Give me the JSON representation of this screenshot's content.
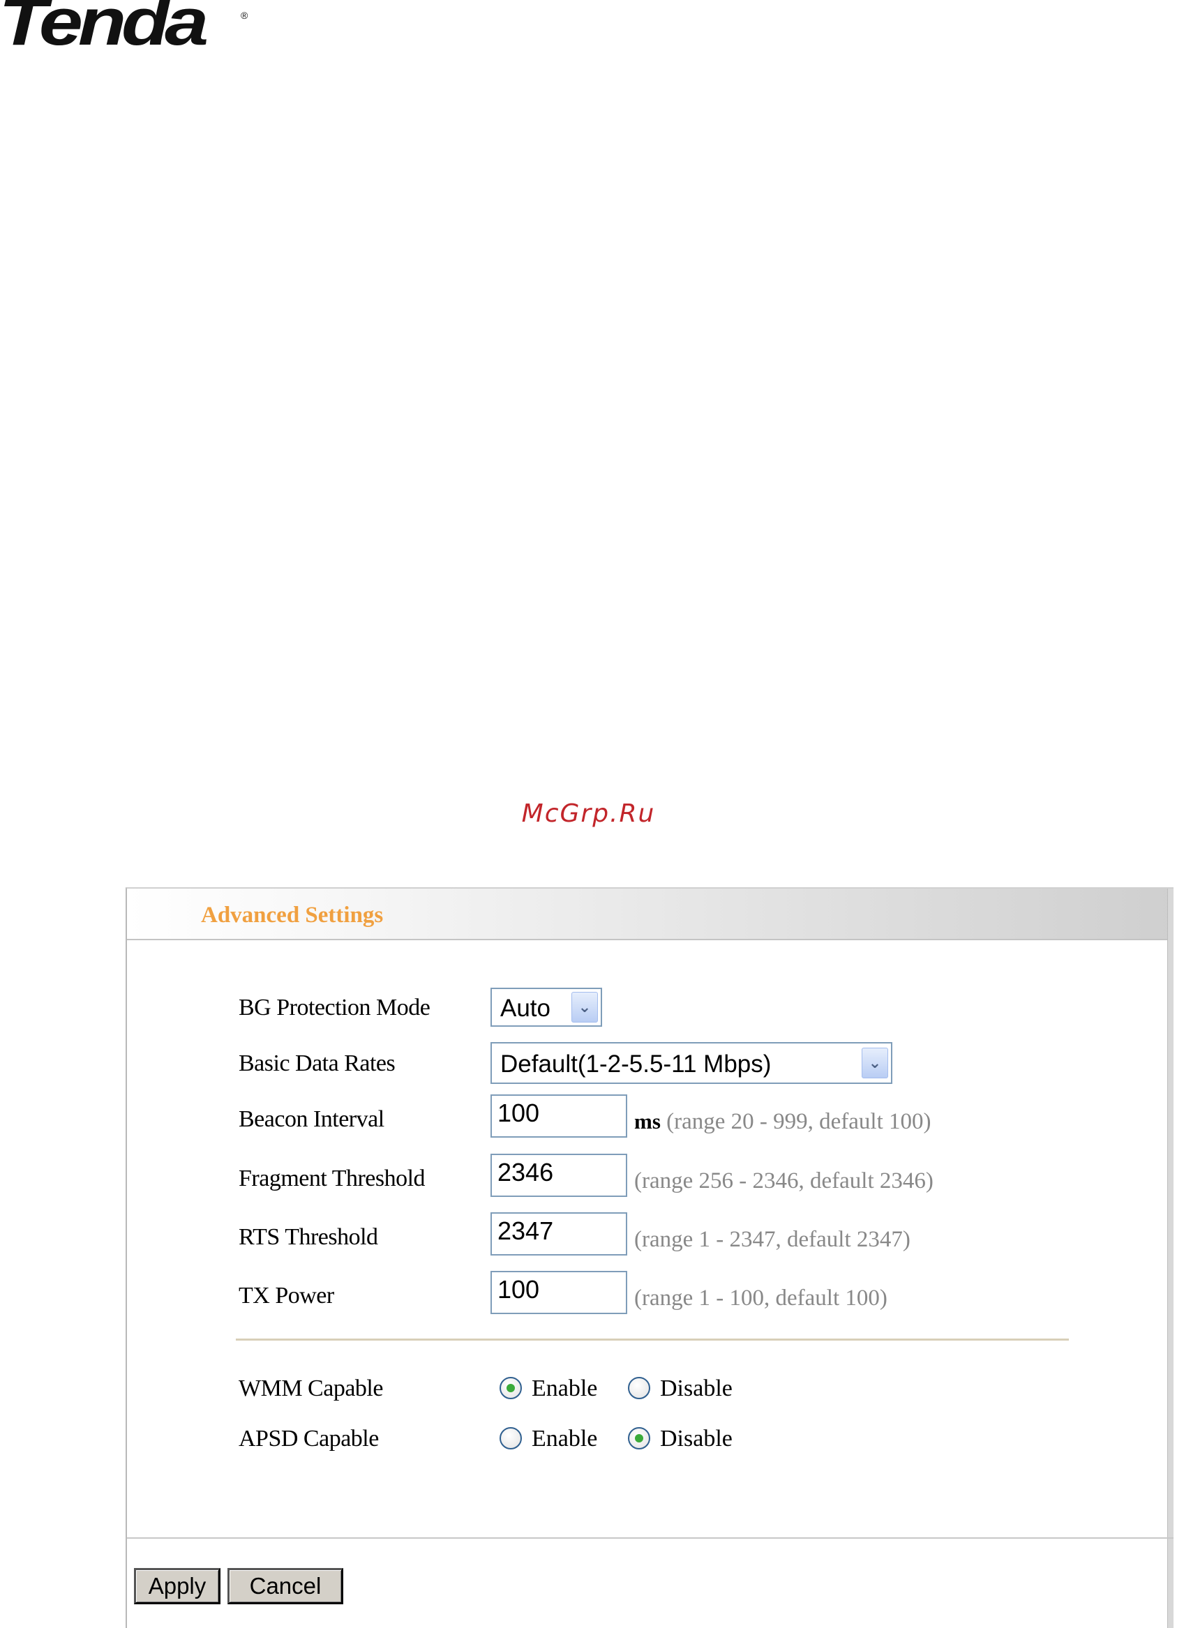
{
  "brand": {
    "logo_text": "Tenda",
    "reg_mark": "®"
  },
  "watermark": "McGrp.Ru",
  "panel": {
    "title": "Advanced Settings",
    "fields": {
      "bg_protection": {
        "label": "BG Protection Mode",
        "value": "Auto"
      },
      "basic_rates": {
        "label": "Basic Data Rates",
        "value": "Default(1-2-5.5-11 Mbps)"
      },
      "beacon": {
        "label": "Beacon Interval",
        "value": "100",
        "unit": "ms",
        "hint": "(range 20 - 999, default 100)"
      },
      "fragment": {
        "label": "Fragment Threshold",
        "value": "2346",
        "hint": "(range 256 - 2346, default 2346)"
      },
      "rts": {
        "label": "RTS Threshold",
        "value": "2347",
        "hint": "(range 1 - 2347, default 2347)"
      },
      "tx_power": {
        "label": "TX Power",
        "value": "100",
        "hint": "(range 1 - 100, default 100)"
      }
    },
    "radios": {
      "wmm": {
        "label": "WMM Capable",
        "enable": "Enable",
        "disable": "Disable",
        "selected": "enable"
      },
      "apsd": {
        "label": "APSD Capable",
        "enable": "Enable",
        "disable": "Disable",
        "selected": "disable"
      }
    },
    "buttons": {
      "apply": "Apply",
      "cancel": "Cancel"
    }
  }
}
